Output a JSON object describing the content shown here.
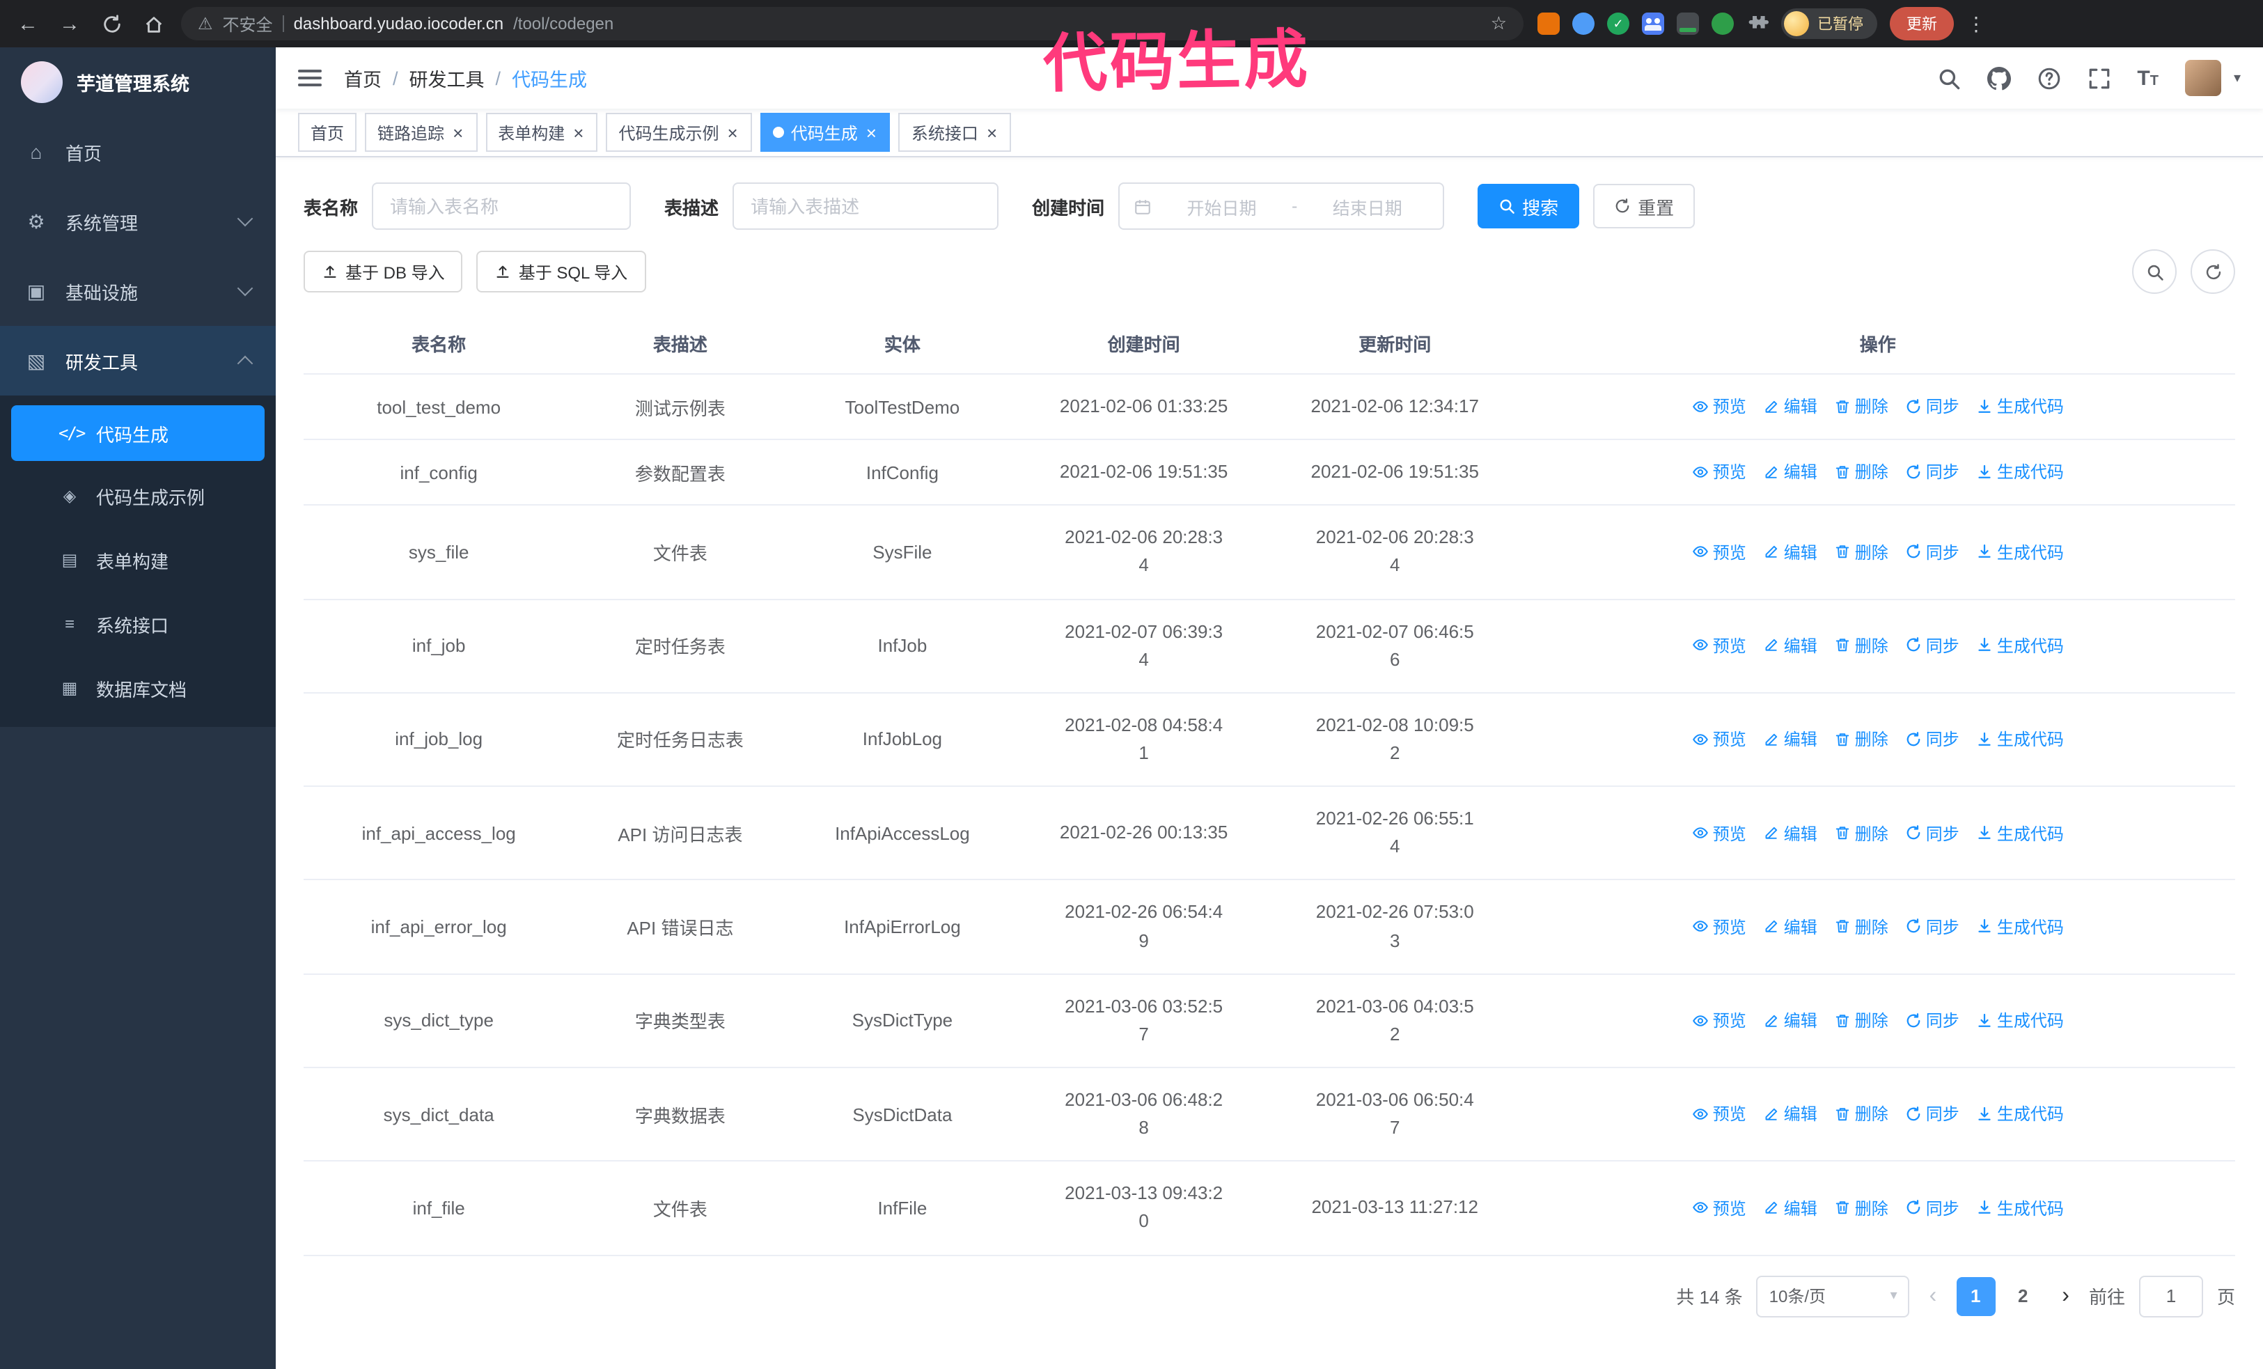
{
  "browser": {
    "security_label": "不安全",
    "url_domain": "dashboard.yudao.iocoder.cn",
    "url_path": "/tool/codegen",
    "profile_badge": "已暂停",
    "update_button": "更新",
    "extension_icons": [
      "fox-extension-icon",
      "drop-extension-icon",
      "check-extension-icon",
      "people-extension-icon",
      "translate-extension-icon",
      "leaf-extension-icon",
      "puzzle-icon"
    ]
  },
  "annotation": {
    "text": "代码生成"
  },
  "sidebar": {
    "logo_title": "芋道管理系统",
    "items": [
      {
        "label": "首页"
      },
      {
        "label": "系统管理"
      },
      {
        "label": "基础设施"
      },
      {
        "label": "研发工具"
      }
    ],
    "submenu": [
      {
        "label": "代码生成",
        "active": true
      },
      {
        "label": "代码生成示例"
      },
      {
        "label": "表单构建"
      },
      {
        "label": "系统接口"
      },
      {
        "label": "数据库文档"
      }
    ]
  },
  "navbar": {
    "breadcrumb": [
      "首页",
      "研发工具",
      "代码生成"
    ],
    "breadcrumb_separator": "/",
    "right_icons": [
      "search-icon",
      "github-icon",
      "help-icon",
      "fullscreen-icon",
      "font-size-icon",
      "avatar"
    ]
  },
  "tabs": [
    {
      "label": "首页",
      "closable": false,
      "active": false
    },
    {
      "label": "链路追踪",
      "closable": true,
      "active": false
    },
    {
      "label": "表单构建",
      "closable": true,
      "active": false
    },
    {
      "label": "代码生成示例",
      "closable": true,
      "active": false
    },
    {
      "label": "代码生成",
      "closable": true,
      "active": true
    },
    {
      "label": "系统接口",
      "closable": true,
      "active": false
    }
  ],
  "filters": {
    "table_name_label": "表名称",
    "table_name_placeholder": "请输入表名称",
    "table_desc_label": "表描述",
    "table_desc_placeholder": "请输入表描述",
    "create_time_label": "创建时间",
    "date_start_placeholder": "开始日期",
    "date_separator": "-",
    "date_end_placeholder": "结束日期",
    "search_button": "搜索",
    "reset_button": "重置"
  },
  "toolbar": {
    "import_db_label": "基于 DB 导入",
    "import_sql_label": "基于 SQL 导入"
  },
  "table": {
    "columns": [
      "表名称",
      "表描述",
      "实体",
      "创建时间",
      "更新时间",
      "操作"
    ],
    "actions": [
      "预览",
      "编辑",
      "删除",
      "同步",
      "生成代码"
    ],
    "rows": [
      {
        "name": "tool_test_demo",
        "desc": "测试示例表",
        "entity": "ToolTestDemo",
        "created": "2021-02-06 01:33:25",
        "updated": "2021-02-06 12:34:17"
      },
      {
        "name": "inf_config",
        "desc": "参数配置表",
        "entity": "InfConfig",
        "created": "2021-02-06 19:51:35",
        "updated": "2021-02-06 19:51:35"
      },
      {
        "name": "sys_file",
        "desc": "文件表",
        "entity": "SysFile",
        "created": "2021-02-06 20:28:3\n4",
        "updated": "2021-02-06 20:28:3\n4"
      },
      {
        "name": "inf_job",
        "desc": "定时任务表",
        "entity": "InfJob",
        "created": "2021-02-07 06:39:3\n4",
        "updated": "2021-02-07 06:46:5\n6"
      },
      {
        "name": "inf_job_log",
        "desc": "定时任务日志表",
        "entity": "InfJobLog",
        "created": "2021-02-08 04:58:4\n1",
        "updated": "2021-02-08 10:09:5\n2"
      },
      {
        "name": "inf_api_access_log",
        "desc": "API 访问日志表",
        "entity": "InfApiAccessLog",
        "created": "2021-02-26 00:13:35",
        "updated": "2021-02-26 06:55:1\n4"
      },
      {
        "name": "inf_api_error_log",
        "desc": "API 错误日志",
        "entity": "InfApiErrorLog",
        "created": "2021-02-26 06:54:4\n9",
        "updated": "2021-02-26 07:53:0\n3"
      },
      {
        "name": "sys_dict_type",
        "desc": "字典类型表",
        "entity": "SysDictType",
        "created": "2021-03-06 03:52:5\n7",
        "updated": "2021-03-06 04:03:5\n2"
      },
      {
        "name": "sys_dict_data",
        "desc": "字典数据表",
        "entity": "SysDictData",
        "created": "2021-03-06 06:48:2\n8",
        "updated": "2021-03-06 06:50:4\n7"
      },
      {
        "name": "inf_file",
        "desc": "文件表",
        "entity": "InfFile",
        "created": "2021-03-13 09:43:2\n0",
        "updated": "2021-03-13 11:27:12"
      }
    ]
  },
  "pagination": {
    "total_label": "共 14 条",
    "page_size": "10条/页",
    "prev_icon": "‹",
    "next_icon": "›",
    "pages": [
      "1",
      "2"
    ],
    "current_page": "1",
    "goto_label": "前往",
    "goto_value": "1",
    "goto_unit": "页"
  },
  "colors": {
    "primary": "#1890ff",
    "tab_active": "#409eff",
    "annotation": "#ff3a7c",
    "sidebar_bg": "#273445",
    "update_button": "#cc5445"
  }
}
